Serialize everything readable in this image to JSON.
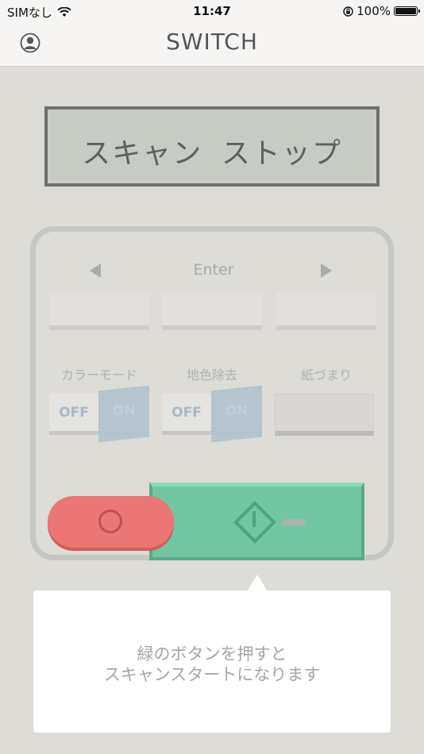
{
  "status_bar": {
    "carrier": "SIMなし",
    "time": "11:47",
    "battery": "100%"
  },
  "nav": {
    "title": "SWITCH"
  },
  "display": {
    "text": "スキャン ストップ"
  },
  "panel": {
    "enter_label": "Enter",
    "function_labels": [
      "カラーモード",
      "地色除去",
      "紙づまり"
    ],
    "toggles": [
      {
        "off_label": "OFF",
        "on_label": "ON"
      },
      {
        "off_label": "OFF",
        "on_label": "ON"
      }
    ]
  },
  "tooltip": {
    "line1": "緑のボタンを押すと",
    "line2": "スキャンスタートになります"
  },
  "colors": {
    "background": "#dddcd7",
    "stop_button": "#ec7673",
    "start_button": "#71c6a1",
    "display": "#c8cac4"
  }
}
